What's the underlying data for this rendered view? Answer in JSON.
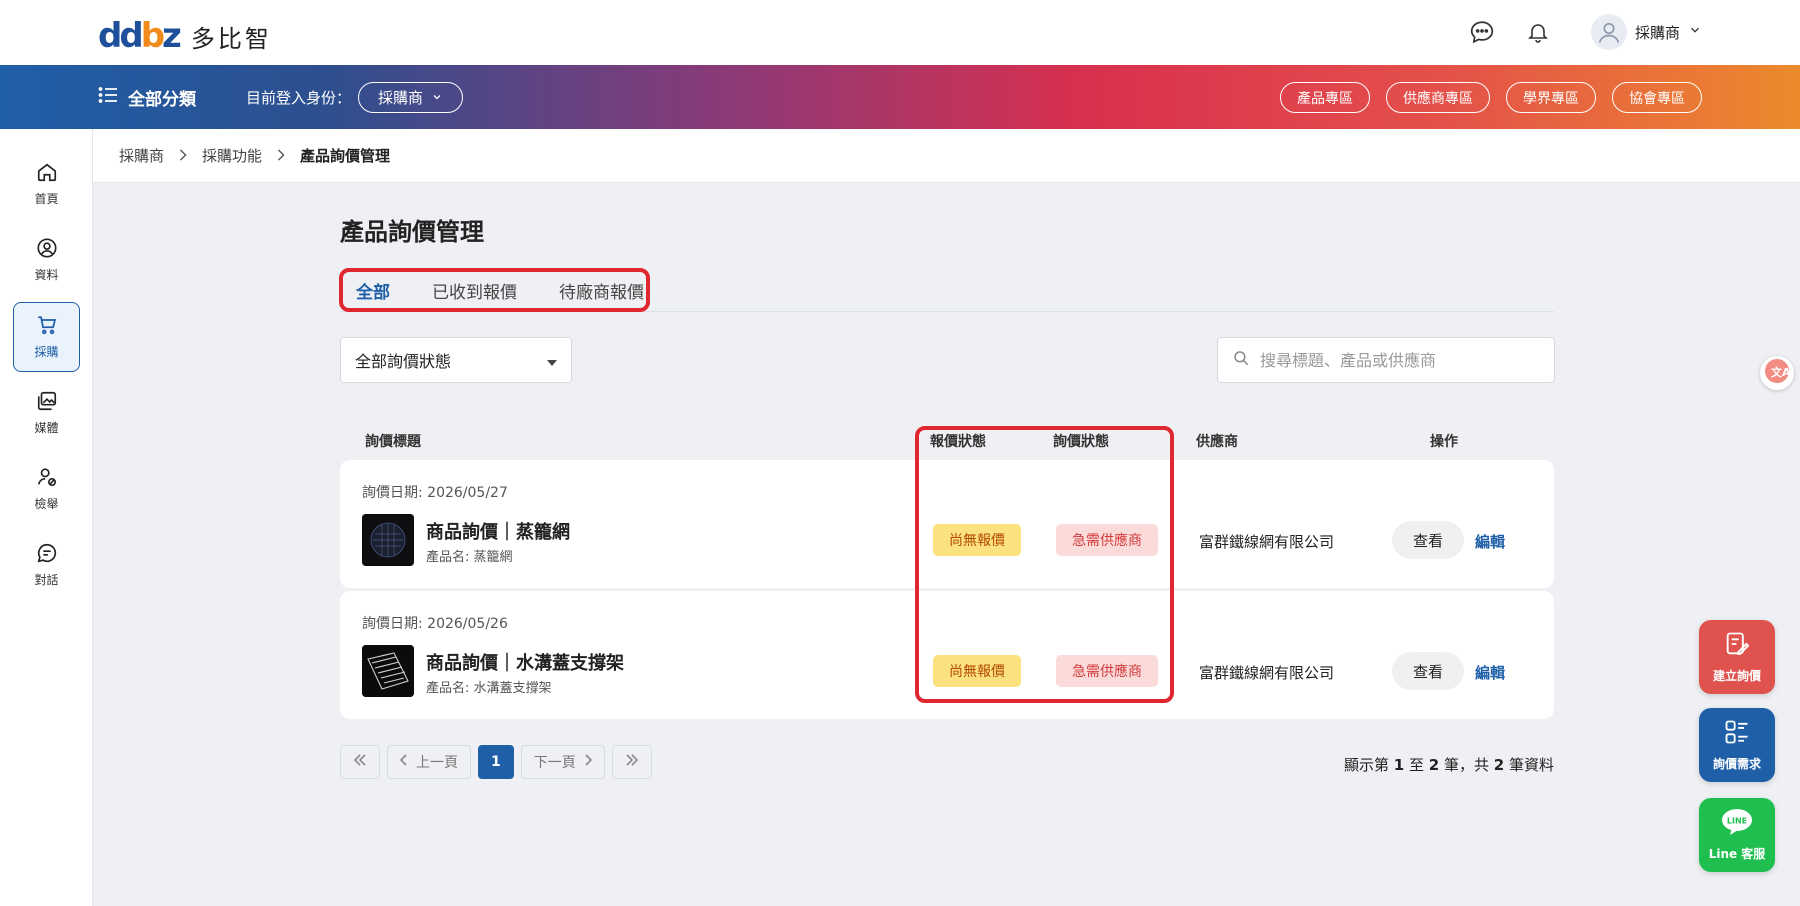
{
  "header": {
    "logo_mark_1": "dd",
    "logo_mark_2": "b",
    "logo_mark_3": "z",
    "logo_text": "多比智",
    "user_name": "採購商"
  },
  "band": {
    "all_categories": "全部分類",
    "role_label": "目前登入身份：",
    "role_value": "採購商",
    "zones": [
      "產品專區",
      "供應商專區",
      "學界專區",
      "協會專區"
    ]
  },
  "sidebar": {
    "items": [
      {
        "label": "首頁",
        "icon": "home-icon"
      },
      {
        "label": "資料",
        "icon": "user-circle-icon"
      },
      {
        "label": "採購",
        "icon": "cart-icon"
      },
      {
        "label": "媒體",
        "icon": "media-icon"
      },
      {
        "label": "檢舉",
        "icon": "report-user-icon"
      },
      {
        "label": "對話",
        "icon": "chat-icon"
      }
    ],
    "active_index": 2
  },
  "breadcrumb": [
    "採購商",
    "採購功能",
    "產品詢價管理"
  ],
  "page": {
    "title": "產品詢價管理",
    "tabs": [
      "全部",
      "已收到報價",
      "待廠商報價"
    ],
    "active_tab": 0,
    "status_filter": "全部詢價狀態",
    "search_placeholder": "搜尋標題、產品或供應商"
  },
  "table": {
    "headers": {
      "title": "詢價標題",
      "quote_status": "報價狀態",
      "inquiry_status": "詢價狀態",
      "supplier": "供應商",
      "actions": "操作"
    },
    "rows": [
      {
        "date": "詢價日期: 2026/05/27",
        "title": "商品詢價｜蒸籠網",
        "product": "產品名: 蒸籠網",
        "quote_status": "尚無報價",
        "inquiry_status": "急需供應商",
        "supplier": "富群鐵線網有限公司",
        "view": "查看",
        "edit": "編輯"
      },
      {
        "date": "詢價日期: 2026/05/26",
        "title": "商品詢價｜水溝蓋支撐架",
        "product": "產品名: 水溝蓋支撐架",
        "quote_status": "尚無報價",
        "inquiry_status": "急需供應商",
        "supplier": "富群鐵線網有限公司",
        "view": "查看",
        "edit": "編輯"
      }
    ]
  },
  "pagination": {
    "prev": "上一頁",
    "next": "下一頁",
    "current": "1",
    "summary_prefix": "顯示第",
    "from": "1",
    "to_word": "至",
    "to": "2",
    "total_word": "筆，共",
    "total": "2",
    "suffix": "筆資料"
  },
  "floating": {
    "create_inquiry": "建立詢價",
    "inquiry_needs": "詢價需求",
    "line_service": "Line 客服",
    "line_logo": "LINE"
  },
  "colors": {
    "primary": "#1f5fa8",
    "highlight_box": "#e0262e",
    "create_btn": "#e0524e",
    "needs_btn": "#1f5fa8",
    "line_btn": "#1fbf4f"
  }
}
